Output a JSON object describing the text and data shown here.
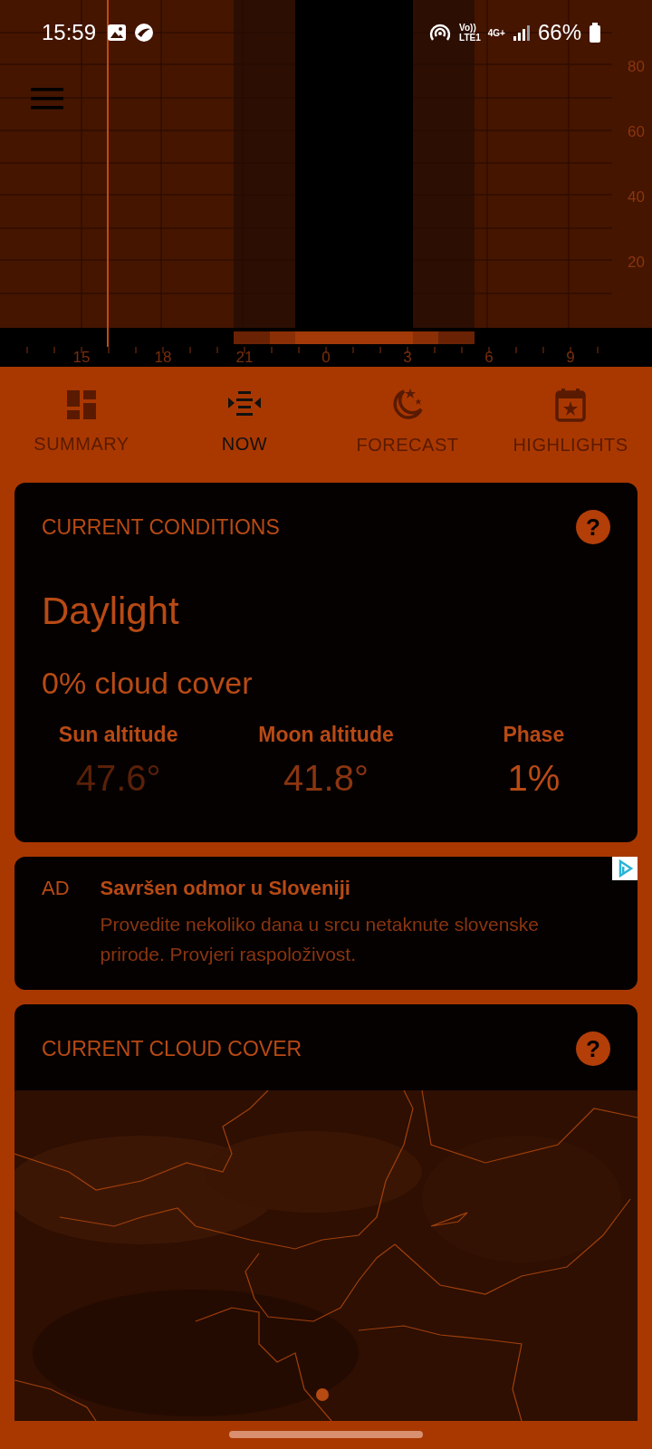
{
  "status_bar": {
    "time": "15:59",
    "network_top": "Vo))",
    "network_bottom": "LTE1",
    "data_type": "4G+",
    "battery": "66%"
  },
  "altitude_chart": {
    "y_ticks": [
      "80",
      "60",
      "40",
      "20"
    ],
    "x_ticks": [
      "15",
      "18",
      "21",
      "0",
      "3",
      "6",
      "9"
    ]
  },
  "tabs": [
    {
      "label": "SUMMARY",
      "selected": false
    },
    {
      "label": "NOW",
      "selected": true
    },
    {
      "label": "FORECAST",
      "selected": false
    },
    {
      "label": "HIGHLIGHTS",
      "selected": false
    }
  ],
  "conditions": {
    "title": "CURRENT CONDITIONS",
    "help": "?",
    "state": "Daylight",
    "cloud_cover": "0% cloud cover",
    "readings": [
      {
        "label": "Sun altitude",
        "value": "47.6°"
      },
      {
        "label": "Moon altitude",
        "value": "41.8°"
      },
      {
        "label": "Phase",
        "value": "1%"
      }
    ]
  },
  "ad": {
    "badge": "AD",
    "title": "Savršen odmor u Sloveniji",
    "body": "Provedite nekoliko dana u srcu netaknute slovenske prirode. Provjeri raspoloživost."
  },
  "cloud_cover": {
    "title": "CURRENT CLOUD COVER",
    "help": "?"
  }
}
